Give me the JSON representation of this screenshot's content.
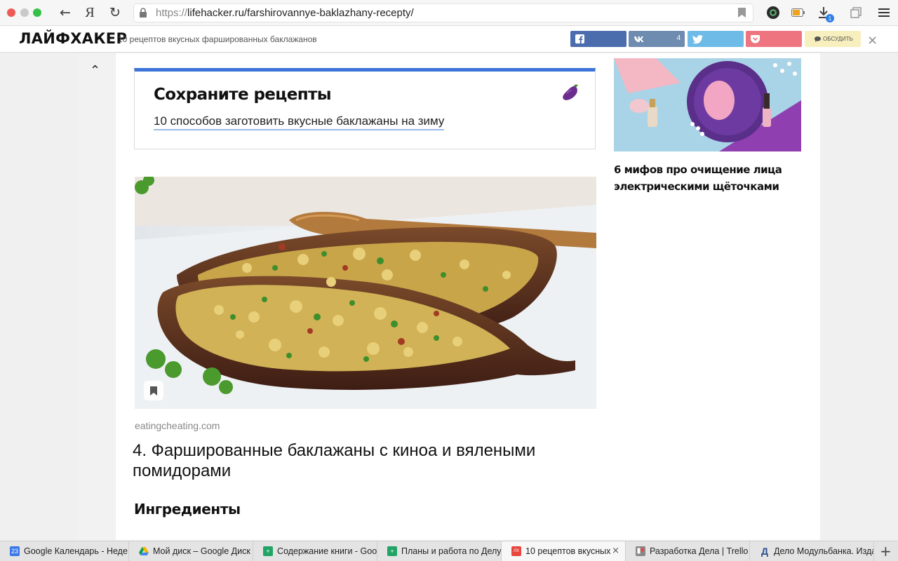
{
  "browser": {
    "url_proto": "https://",
    "url_rest": "lifehacker.ru/farshirovannye-baklazhany-recepty/",
    "ya_label": "Я",
    "download_badge": "1",
    "back_icon": "←",
    "reload_icon": "↻"
  },
  "header": {
    "logo": "ЛАЙФХАКЕР",
    "title": "10 рецептов вкусных фаршированных баклажанов",
    "share_vk_count": "4",
    "discuss_label": "ОБСУДИТЬ",
    "close_icon": "×",
    "colors": {
      "facebook": "#4b6dae",
      "vk": "#6e8bb0",
      "twitter": "#6fbbe8",
      "pocket": "#ee7480",
      "discuss": "#f7efbd"
    }
  },
  "main": {
    "scroll_up_icon": "⌃",
    "save_card": {
      "title": "Сохраните рецепты",
      "link": "10 способов заготовить вкусные баклажаны на зиму",
      "accent": "#3b73d8"
    },
    "photo_source": "eatingcheating.com",
    "recipe_title": "4. Фаршированные баклажаны с киноа и вялеными помидорами",
    "ingredients_heading": "Ингредиенты"
  },
  "sidebar": {
    "article_title": "6 мифов про очищение лица электрическими щёточками"
  },
  "tabs": [
    {
      "label": "Google Календарь - Неде",
      "favicon": "23",
      "color": "#3b78e7"
    },
    {
      "label": "Мой диск – Google Диск",
      "favicon": "",
      "color": "#f4b400"
    },
    {
      "label": "Содержание книги - Goo",
      "favicon": "+",
      "color": "#21a464"
    },
    {
      "label": "Планы и работа по Делу",
      "favicon": "+",
      "color": "#21a464"
    },
    {
      "label": "10 рецептов вкусных ф",
      "favicon": "ЛХ",
      "color": "#e8473f",
      "active": true
    },
    {
      "label": "Разработка Дела | Trello",
      "favicon": "",
      "color": "#888888"
    },
    {
      "label": "Дело Модульбанка. Изда",
      "favicon": "Д",
      "color": "#2a4d8f"
    }
  ],
  "tab_close_icon": "×",
  "new_tab_icon": "+"
}
